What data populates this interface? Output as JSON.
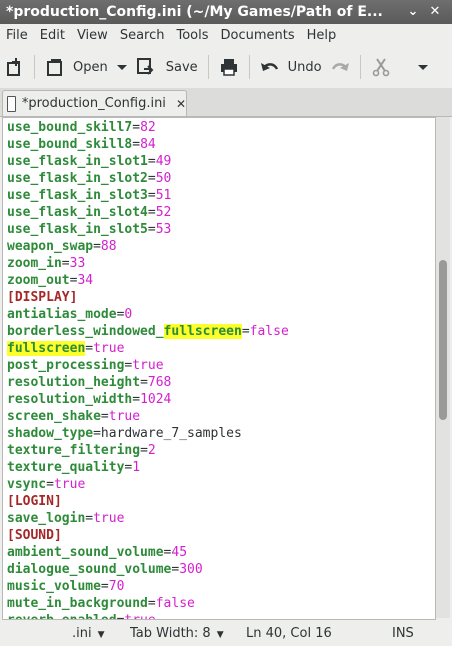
{
  "window": {
    "title": "*production_Config.ini (~/My Games/Path of E...",
    "minimize": "⌄",
    "close": "✕"
  },
  "menu": [
    "File",
    "Edit",
    "View",
    "Search",
    "Tools",
    "Documents",
    "Help"
  ],
  "toolbar": {
    "open_label": "Open",
    "save_label": "Save",
    "undo_label": "Undo"
  },
  "tab": {
    "label": "*production_Config.ini",
    "close": "✕"
  },
  "editor": {
    "lines": [
      {
        "key": "use_bound_skill7",
        "value": "82",
        "type": "num"
      },
      {
        "key": "use_bound_skill8",
        "value": "84",
        "type": "num"
      },
      {
        "key": "use_flask_in_slot1",
        "value": "49",
        "type": "num"
      },
      {
        "key": "use_flask_in_slot2",
        "value": "50",
        "type": "num"
      },
      {
        "key": "use_flask_in_slot3",
        "value": "51",
        "type": "num"
      },
      {
        "key": "use_flask_in_slot4",
        "value": "52",
        "type": "num"
      },
      {
        "key": "use_flask_in_slot5",
        "value": "53",
        "type": "num"
      },
      {
        "key": "weapon_swap",
        "value": "88",
        "type": "num"
      },
      {
        "key": "zoom_in",
        "value": "33",
        "type": "num"
      },
      {
        "key": "zoom_out",
        "value": "34",
        "type": "num"
      },
      {
        "section": "[DISPLAY]"
      },
      {
        "key": "antialias_mode",
        "value": "0",
        "type": "num"
      },
      {
        "key": "borderless_windowed_",
        "hl": "fullscreen",
        "value": "false",
        "type": "num"
      },
      {
        "keyhl": "fullscreen",
        "value": "true",
        "type": "num"
      },
      {
        "key": "post_processing",
        "value": "true",
        "type": "num"
      },
      {
        "key": "resolution_height",
        "value": "768",
        "type": "num"
      },
      {
        "key": "resolution_width",
        "value": "1024",
        "type": "num"
      },
      {
        "key": "screen_shake",
        "value": "true",
        "type": "num"
      },
      {
        "key": "shadow_type",
        "value": "hardware_7_samples",
        "type": "plain"
      },
      {
        "key": "texture_filtering",
        "value": "2",
        "type": "num"
      },
      {
        "key": "texture_quality",
        "value": "1",
        "type": "num"
      },
      {
        "key": "vsync",
        "value": "true",
        "type": "num"
      },
      {
        "section": "[LOGIN]"
      },
      {
        "key": "save_login",
        "value": "true",
        "type": "num"
      },
      {
        "section": "[SOUND]"
      },
      {
        "key": "ambient_sound_volume",
        "value": "45",
        "type": "num"
      },
      {
        "key": "dialogue_sound_volume",
        "value": "300",
        "type": "num"
      },
      {
        "key": "music_volume",
        "value": "70",
        "type": "num"
      },
      {
        "key": "mute_in_background",
        "value": "false",
        "type": "num"
      },
      {
        "key": "reverb_enabled",
        "value": "true",
        "type": "num"
      }
    ]
  },
  "status": {
    "language": ".ini",
    "tab_width": "Tab Width:  8",
    "position": "Ln 40, Col 16",
    "mode": "INS"
  },
  "scrollbar": {
    "position": 0.42
  }
}
